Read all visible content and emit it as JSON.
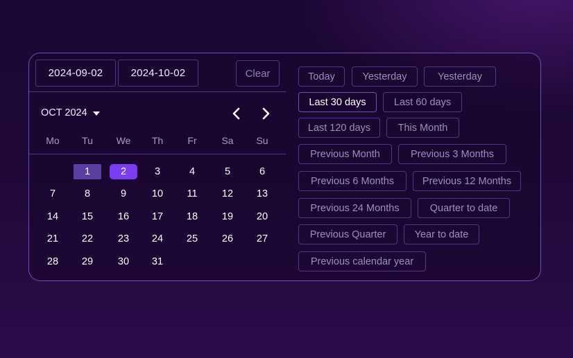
{
  "date_range": {
    "start": "2024-09-02",
    "end": "2024-10-02",
    "clear_label": "Clear"
  },
  "calendar": {
    "month_label": "OCT 2024",
    "prev_icon": "chevron-left-icon",
    "next_icon": "chevron-right-icon",
    "weekdays": [
      "Mo",
      "Tu",
      "We",
      "Th",
      "Fr",
      "Sa",
      "Su"
    ],
    "weeks": [
      [
        "",
        "1",
        "2",
        "3",
        "4",
        "5",
        "6"
      ],
      [
        "7",
        "8",
        "9",
        "10",
        "11",
        "12",
        "13"
      ],
      [
        "14",
        "15",
        "16",
        "17",
        "18",
        "19",
        "20"
      ],
      [
        "21",
        "22",
        "23",
        "24",
        "25",
        "26",
        "27"
      ],
      [
        "28",
        "29",
        "30",
        "31",
        "",
        "",
        ""
      ]
    ],
    "range_start_day": "1",
    "range_end_day": "2"
  },
  "presets": {
    "active": "Last 30 days",
    "items": [
      "Today",
      "Yesterday",
      "Yesterday",
      "Last 30 days",
      "Last 60 days",
      "Last 120 days",
      "This Month",
      "Previous Month",
      "Previous 3 Months",
      "Previous 6 Months",
      "Previous 12 Months",
      "Previous 24 Months",
      "Quarter to date",
      "Previous Quarter",
      "Year to date",
      "Previous calendar year"
    ]
  },
  "colors": {
    "accent": "#7a3df0",
    "range_start_bg": "#5a3f9e",
    "border": "#4b3a86",
    "panel_border": "#6c52b6"
  }
}
